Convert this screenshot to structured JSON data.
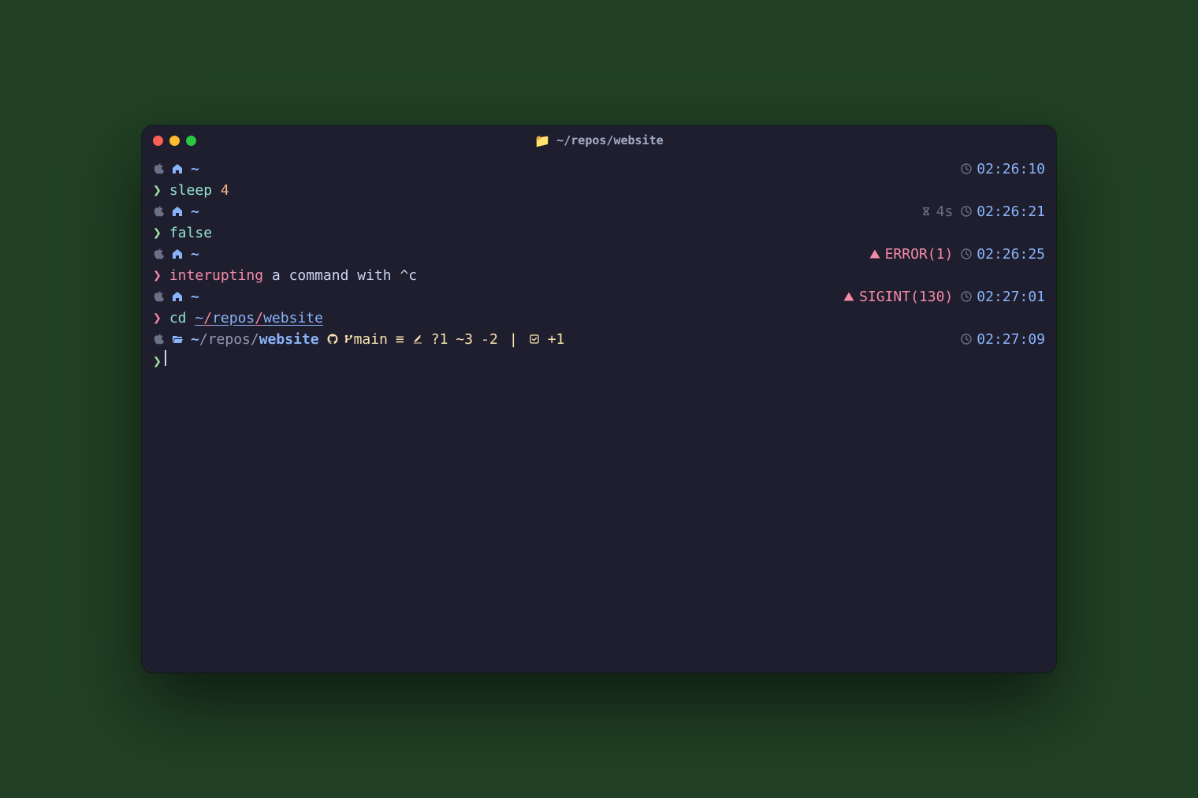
{
  "window": {
    "title": "~/repos/website"
  },
  "blocks": [
    {
      "context": {
        "path": "~",
        "path_segments": null
      },
      "right": {
        "duration": null,
        "status": null,
        "time": "02:26:10"
      },
      "command": {
        "caret_color": "green",
        "parts": [
          {
            "text": "sleep",
            "color": "teal"
          },
          {
            "text": " ",
            "color": "fg"
          },
          {
            "text": "4",
            "color": "peach"
          }
        ]
      }
    },
    {
      "context": {
        "path": "~",
        "path_segments": null
      },
      "right": {
        "duration": "4s",
        "status": null,
        "time": "02:26:21"
      },
      "command": {
        "caret_color": "green",
        "parts": [
          {
            "text": "false",
            "color": "teal"
          }
        ]
      }
    },
    {
      "context": {
        "path": "~",
        "path_segments": null
      },
      "right": {
        "duration": null,
        "status": "ERROR(1)",
        "time": "02:26:25"
      },
      "command": {
        "caret_color": "red",
        "parts": [
          {
            "text": "interupting",
            "color": "red"
          },
          {
            "text": " a command with ^c",
            "color": "fg"
          }
        ]
      }
    },
    {
      "context": {
        "path": "~",
        "path_segments": null
      },
      "right": {
        "duration": null,
        "status": "SIGINT(130)",
        "time": "02:27:01"
      },
      "command": {
        "caret_color": "red",
        "parts": [
          {
            "text": "cd",
            "color": "teal"
          },
          {
            "text": " ",
            "color": "fg"
          },
          {
            "text": "~",
            "color": "blue",
            "underline": true
          },
          {
            "text": "/",
            "color": "red",
            "underline": true
          },
          {
            "text": "repos",
            "color": "blue",
            "underline": true
          },
          {
            "text": "/",
            "color": "red",
            "underline": true
          },
          {
            "text": "website",
            "color": "blue",
            "underline": true
          }
        ]
      }
    }
  ],
  "final": {
    "context": {
      "path_segments": [
        {
          "text": "~",
          "color": "blue"
        },
        {
          "text": "/",
          "color": "overlay"
        },
        {
          "text": "repos",
          "color": "overlay"
        },
        {
          "text": "/",
          "color": "overlay"
        },
        {
          "text": "website",
          "color": "blue",
          "bold": true
        }
      ],
      "git": {
        "branch": "main",
        "sync": "≡",
        "pen_icon": true,
        "untracked": "?1",
        "modified": "~3",
        "deleted": "-2",
        "sep": "|",
        "stash_icon": true,
        "stash": "+1"
      }
    },
    "right": {
      "time": "02:27:09"
    },
    "prompt": {
      "caret_color": "green"
    }
  }
}
